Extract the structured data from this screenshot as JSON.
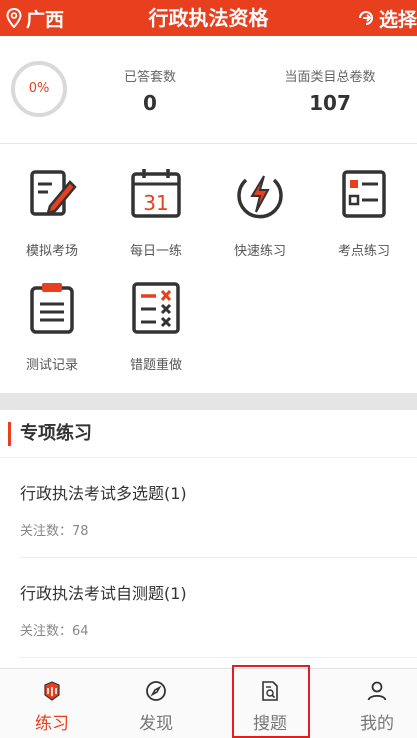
{
  "header": {
    "location": "广西",
    "title": "行政执法资格",
    "select_label": "选择"
  },
  "stats": {
    "progress_label": "0%",
    "progress_fraction": 0,
    "answered_label": "已答套数",
    "answered_value": "0",
    "total_label": "当面类目总卷数",
    "total_value": "107"
  },
  "grid": [
    {
      "label": "模拟考场",
      "icon": "exam-edit-icon"
    },
    {
      "label": "每日一练",
      "icon": "calendar-icon"
    },
    {
      "label": "快速练习",
      "icon": "lightning-icon"
    },
    {
      "label": "考点练习",
      "icon": "checklist-icon"
    },
    {
      "label": "测试记录",
      "icon": "clipboard-icon"
    },
    {
      "label": "错题重做",
      "icon": "wrong-list-icon"
    }
  ],
  "calendar_day": "31",
  "section": {
    "title": "专项练习",
    "items": [
      {
        "name": "行政执法考试多选题(1)",
        "meta": "关注数：78"
      },
      {
        "name": "行政执法考试自测题(1)",
        "meta": "关注数：64"
      }
    ]
  },
  "nav": [
    {
      "label": "练习",
      "icon": "pencil-icon",
      "active": true
    },
    {
      "label": "发现",
      "icon": "compass-icon",
      "active": false
    },
    {
      "label": "搜题",
      "icon": "search-document-icon",
      "active": false
    },
    {
      "label": "我的",
      "icon": "user-icon",
      "active": false
    }
  ],
  "colors": {
    "accent": "#e8401f",
    "highlight_border": "#e02020"
  }
}
